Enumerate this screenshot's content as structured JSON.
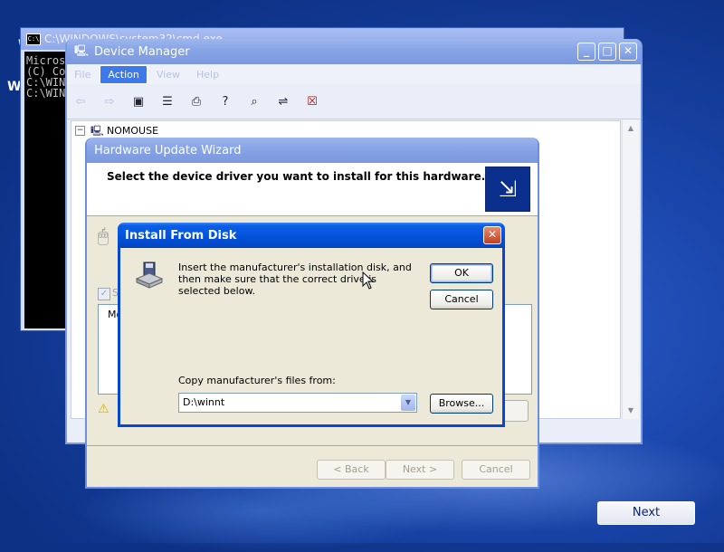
{
  "colors": {
    "xp_title_active": "#0a5ee6",
    "xp_title_inactive": "#88a5e6",
    "desktop": "#1a46ab"
  },
  "desktop": {
    "letter": "W",
    "letter2": "W",
    "next_label": "Next"
  },
  "cmd": {
    "title": "C:\\WINDOWS\\system32\\cmd.exe",
    "icon": "C:\\",
    "lines": [
      "Microsoft",
      "(C) Co",
      "",
      "C:\\WIN",
      "",
      "C:\\WIN"
    ]
  },
  "device_manager": {
    "title": "Device Manager",
    "menu": [
      "File",
      "Action",
      "View",
      "Help"
    ],
    "tree_item": "NOMOUSE",
    "tree_expander": "−",
    "toolbar_icons": [
      "back-icon",
      "forward-icon",
      "console-tree-icon",
      "properties-icon",
      "print-icon",
      "help-icon",
      "scan-hardware-icon",
      "update-driver-icon",
      "disable-icon",
      "uninstall-icon"
    ]
  },
  "wizard": {
    "title": "Hardware Update Wizard",
    "header_text": "Select the device driver you want to install for this hardware.",
    "check_partial": "S",
    "list_partial": "Mo",
    "back_label": "< Back",
    "next_label": "Next >",
    "cancel_label": "Cancel"
  },
  "install_from_disk": {
    "title": "Install From Disk",
    "message": "Insert the manufacturer's installation disk, and then make sure that the correct drive is selected below.",
    "ok_label": "OK",
    "cancel_label": "Cancel",
    "copy_label": "Copy manufacturer's files from:",
    "path_value": "D:\\winnt",
    "browse_label": "Browse..."
  }
}
